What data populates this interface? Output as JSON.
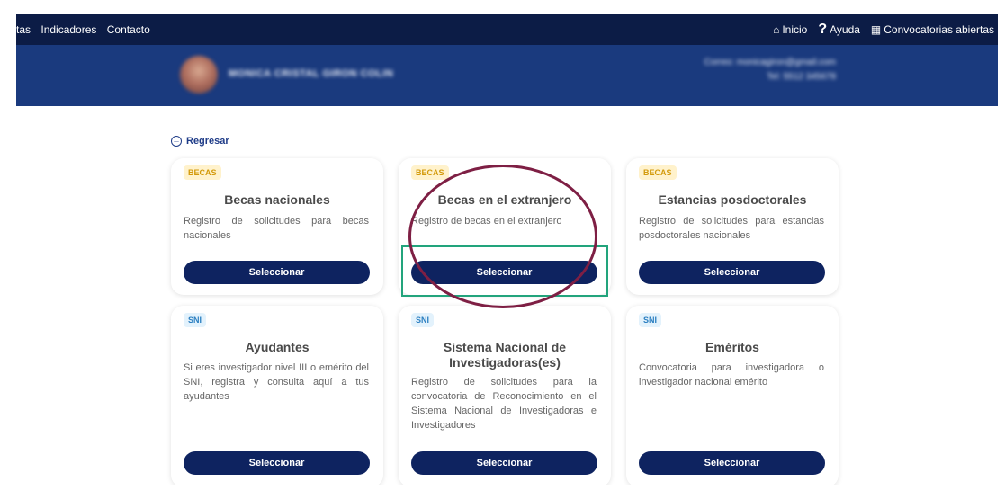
{
  "topbar": {
    "left_items": [
      "tas",
      "Indicadores",
      "Contacto"
    ],
    "right_items": [
      {
        "icon": "home-icon",
        "label": "Inicio"
      },
      {
        "icon": "help-icon",
        "label": "Ayuda"
      },
      {
        "icon": "book-icon",
        "label": "Convocatorias abiertas"
      }
    ]
  },
  "banner": {
    "user_name": "MONICA CRISTAL GIRON COLIN",
    "user_email": "Correo: monicagiron@gmail.com",
    "user_phone": "Tel: 5512 345678"
  },
  "back_link": "Regresar",
  "cards": [
    {
      "badge": "BECAS",
      "title": "Becas nacionales",
      "desc": "Registro de solicitudes para becas nacionales",
      "button": "Seleccionar"
    },
    {
      "badge": "BECAS",
      "title": "Becas en el extranjero",
      "desc": "Registro de becas en el extranjero",
      "button": "Seleccionar"
    },
    {
      "badge": "BECAS",
      "title": "Estancias posdoctorales",
      "desc": "Registro de solicitudes para estancias posdoctorales nacionales",
      "button": "Seleccionar"
    },
    {
      "badge": "SNI",
      "title": "Ayudantes",
      "desc": "Si eres investigador nivel III o emérito del SNI, registra y consulta aquí a tus ayudantes",
      "button": "Seleccionar"
    },
    {
      "badge": "SNI",
      "title": "Sistema Nacional de Investigadoras(es)",
      "desc": "Registro de solicitudes para la convocatoria de Reconocimiento en el Sistema Nacional de Investigadoras e Investigadores",
      "button": "Seleccionar"
    },
    {
      "badge": "SNI",
      "title": "Eméritos",
      "desc": "Convocatoria para investigadora o investigador nacional emérito",
      "button": "Seleccionar"
    }
  ],
  "colors": {
    "topbar": "#0c1c46",
    "banner": "#1a3a7e",
    "button": "#0e2360",
    "highlight_rect": "#22a47c",
    "highlight_circle": "#7e1f44"
  }
}
